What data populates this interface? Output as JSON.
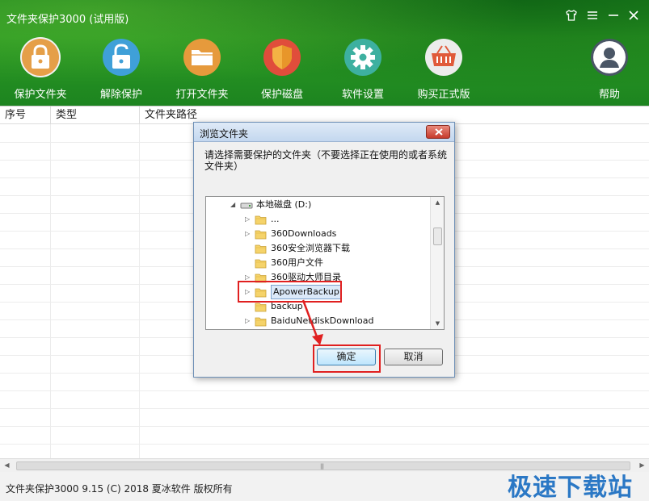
{
  "app": {
    "title": "文件夹保护3000 (试用版)",
    "accent_color": "#2a9a23"
  },
  "window_controls": [
    {
      "name": "skin",
      "icon": "shirt-icon"
    },
    {
      "name": "menu",
      "icon": "menu-icon"
    },
    {
      "name": "minimize",
      "icon": "minimize-icon"
    },
    {
      "name": "close",
      "icon": "close-icon"
    }
  ],
  "toolbar": {
    "items": [
      {
        "label": "保护文件夹",
        "icon": "lock-icon",
        "color": "#e6a04a"
      },
      {
        "label": "解除保护",
        "icon": "unlock-icon",
        "color": "#3fa0d8"
      },
      {
        "label": "打开文件夹",
        "icon": "folder-icon",
        "color": "#e69a3c"
      },
      {
        "label": "保护磁盘",
        "icon": "shield-icon",
        "color": "#e04d3b"
      },
      {
        "label": "软件设置",
        "icon": "gear-icon",
        "color": "#3db0a0"
      },
      {
        "label": "购买正式版",
        "icon": "basket-icon",
        "color": "#e05a3a"
      },
      {
        "label": "帮助",
        "icon": "user-icon",
        "color": "#4a5666"
      }
    ]
  },
  "table": {
    "columns": [
      "序号",
      "类型",
      "文件夹路径"
    ]
  },
  "status_bar": {
    "text": "文件夹保护3000 9.15 (C) 2018 夏冰软件 版权所有"
  },
  "watermark": "极速下载站",
  "dialog": {
    "title": "浏览文件夹",
    "description": "请选择需要保护的文件夹（不要选择正在使用的或者系统文件夹）",
    "tree": [
      {
        "label": "本地磁盘 (D:)",
        "kind": "drive",
        "expanded": true
      },
      {
        "label": "...",
        "kind": "folder",
        "has_children": true
      },
      {
        "label": "360Downloads",
        "kind": "folder",
        "has_children": true
      },
      {
        "label": "360安全浏览器下载",
        "kind": "folder",
        "has_children": false
      },
      {
        "label": "360用户文件",
        "kind": "folder",
        "has_children": false
      },
      {
        "label": "360驱动大师目录",
        "kind": "folder",
        "has_children": true
      },
      {
        "label": "ApowerBackup",
        "kind": "folder",
        "has_children": true,
        "selected": true
      },
      {
        "label": "backup",
        "kind": "folder",
        "has_children": false
      },
      {
        "label": "BaiduNetdiskDownload",
        "kind": "folder",
        "has_children": true
      }
    ],
    "ok_label": "确定",
    "cancel_label": "取消"
  }
}
